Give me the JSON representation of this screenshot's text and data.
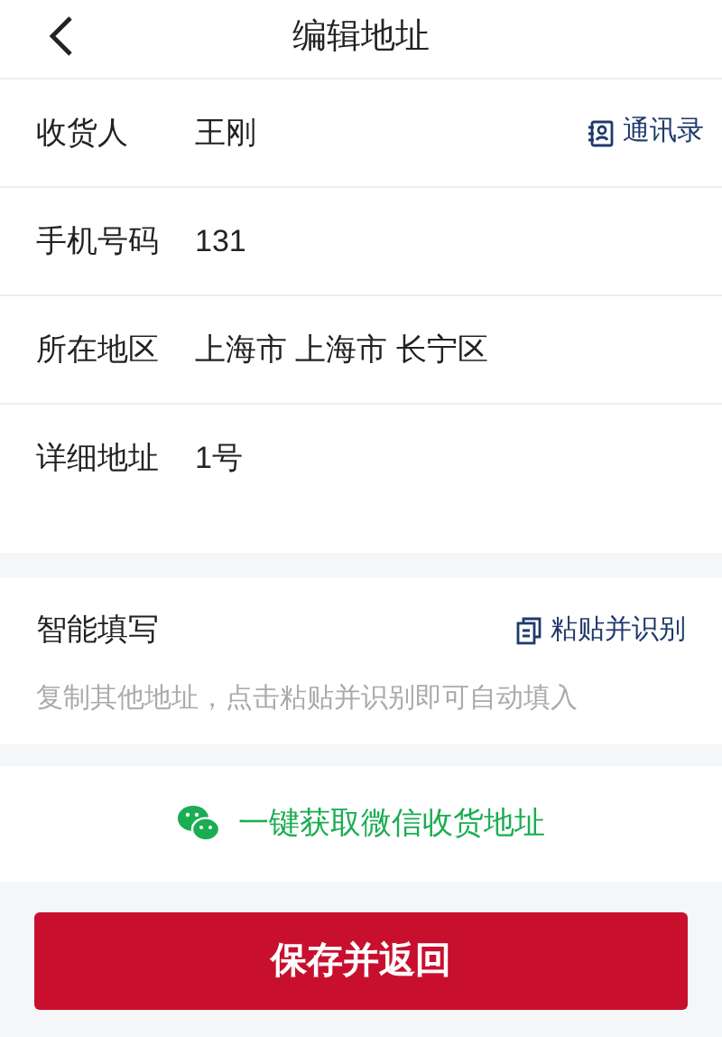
{
  "header": {
    "title": "编辑地址"
  },
  "fields": [
    {
      "label": "收货人",
      "value": "王刚",
      "action": "通讯录"
    },
    {
      "label": "手机号码",
      "value": "131"
    },
    {
      "label": "所在地区",
      "value": "上海市 上海市 长宁区"
    },
    {
      "label": "详细地址",
      "value": "1号"
    }
  ],
  "smart_fill": {
    "title": "智能填写",
    "action": "粘贴并识别",
    "placeholder": "复制其他地址，点击粘贴并识别即可自动填入"
  },
  "wechat_link": "一键获取微信收货地址",
  "save_button": "保存并返回"
}
